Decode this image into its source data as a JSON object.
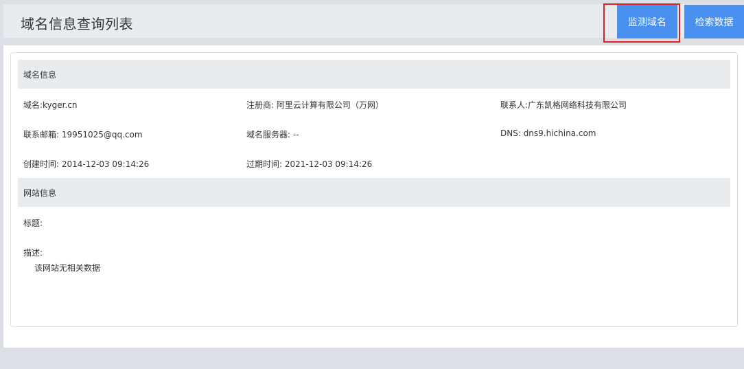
{
  "header": {
    "title": "域名信息查询列表",
    "monitor_button": "监测域名",
    "search_button": "检索数据"
  },
  "domain_section": {
    "heading": "域名信息",
    "domain": "域名:kyger.cn",
    "registrar": "注册商: 阿里云计算有限公司（万网）",
    "contact": "联系人:广东凯格网络科技有限公司",
    "email": "联系邮箱: 19951025@qq.com",
    "name_server": "域名服务器: --",
    "dns": "DNS: dns9.hichina.com",
    "created": "创建时间: 2014-12-03 09:14:26",
    "expires": "过期时间: 2021-12-03 09:14:26"
  },
  "site_section": {
    "heading": "网站信息",
    "title_label": "标题:",
    "desc_label": "描述:",
    "desc_value": "该网站无相关数据"
  },
  "colors": {
    "button": "#4a90f0",
    "highlight": "#e02020",
    "header_bg": "#e9ecef",
    "page_bg": "#dcdfe6"
  }
}
